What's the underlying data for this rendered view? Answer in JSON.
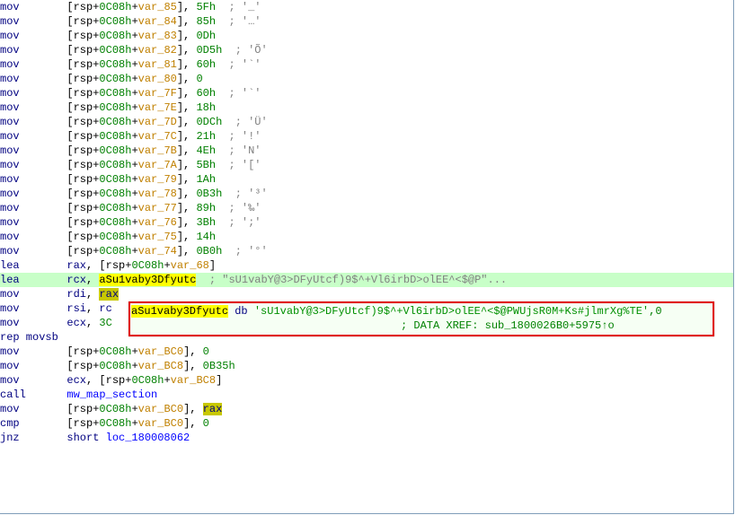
{
  "lines": [
    {
      "op": "mov",
      "dst_pre": "[rsp+",
      "off": "0C08h",
      "plus": "+",
      "var": "var_85",
      "dst_post": "], ",
      "val": "5Fh",
      "cmt": "; '_'"
    },
    {
      "op": "mov",
      "dst_pre": "[rsp+",
      "off": "0C08h",
      "plus": "+",
      "var": "var_84",
      "dst_post": "], ",
      "val": "85h",
      "cmt": "; '…'"
    },
    {
      "op": "mov",
      "dst_pre": "[rsp+",
      "off": "0C08h",
      "plus": "+",
      "var": "var_83",
      "dst_post": "], ",
      "val": "0Dh",
      "cmt": ""
    },
    {
      "op": "mov",
      "dst_pre": "[rsp+",
      "off": "0C08h",
      "plus": "+",
      "var": "var_82",
      "dst_post": "], ",
      "val": "0D5h",
      "cmt": "; 'Õ'"
    },
    {
      "op": "mov",
      "dst_pre": "[rsp+",
      "off": "0C08h",
      "plus": "+",
      "var": "var_81",
      "dst_post": "], ",
      "val": "60h",
      "cmt": "; '`'"
    },
    {
      "op": "mov",
      "dst_pre": "[rsp+",
      "off": "0C08h",
      "plus": "+",
      "var": "var_80",
      "dst_post": "], ",
      "val": "0",
      "cmt": ""
    },
    {
      "op": "mov",
      "dst_pre": "[rsp+",
      "off": "0C08h",
      "plus": "+",
      "var": "var_7F",
      "dst_post": "], ",
      "val": "60h",
      "cmt": "; '`'"
    },
    {
      "op": "mov",
      "dst_pre": "[rsp+",
      "off": "0C08h",
      "plus": "+",
      "var": "var_7E",
      "dst_post": "], ",
      "val": "18h",
      "cmt": ""
    },
    {
      "op": "mov",
      "dst_pre": "[rsp+",
      "off": "0C08h",
      "plus": "+",
      "var": "var_7D",
      "dst_post": "], ",
      "val": "0DCh",
      "cmt": "; 'Ü'"
    },
    {
      "op": "mov",
      "dst_pre": "[rsp+",
      "off": "0C08h",
      "plus": "+",
      "var": "var_7C",
      "dst_post": "], ",
      "val": "21h",
      "cmt": "; '!'"
    },
    {
      "op": "mov",
      "dst_pre": "[rsp+",
      "off": "0C08h",
      "plus": "+",
      "var": "var_7B",
      "dst_post": "], ",
      "val": "4Eh",
      "cmt": "; 'N'"
    },
    {
      "op": "mov",
      "dst_pre": "[rsp+",
      "off": "0C08h",
      "plus": "+",
      "var": "var_7A",
      "dst_post": "], ",
      "val": "5Bh",
      "cmt": "; '['"
    },
    {
      "op": "mov",
      "dst_pre": "[rsp+",
      "off": "0C08h",
      "plus": "+",
      "var": "var_79",
      "dst_post": "], ",
      "val": "1Ah",
      "cmt": ""
    },
    {
      "op": "mov",
      "dst_pre": "[rsp+",
      "off": "0C08h",
      "plus": "+",
      "var": "var_78",
      "dst_post": "], ",
      "val": "0B3h",
      "cmt": "; '³'"
    },
    {
      "op": "mov",
      "dst_pre": "[rsp+",
      "off": "0C08h",
      "plus": "+",
      "var": "var_77",
      "dst_post": "], ",
      "val": "89h",
      "cmt": "; '‰'"
    },
    {
      "op": "mov",
      "dst_pre": "[rsp+",
      "off": "0C08h",
      "plus": "+",
      "var": "var_76",
      "dst_post": "], ",
      "val": "3Bh",
      "cmt": "; ';'"
    },
    {
      "op": "mov",
      "dst_pre": "[rsp+",
      "off": "0C08h",
      "plus": "+",
      "var": "var_75",
      "dst_post": "], ",
      "val": "14h",
      "cmt": ""
    },
    {
      "op": "mov",
      "dst_pre": "[rsp+",
      "off": "0C08h",
      "plus": "+",
      "var": "var_74",
      "dst_post": "], ",
      "val": "0B0h",
      "cmt": "; '°'"
    }
  ],
  "lea1": {
    "op": "lea",
    "reg": "rax",
    "off": "0C08h",
    "var": "var_68"
  },
  "lea2": {
    "op": "lea",
    "reg": "rcx",
    "sym": "aSu1vaby3Dfyutc",
    "cmt": "; \"sU1vabY@3>DFyUtcf)9$^+Vl6irbD>olEE^<$@P\"..."
  },
  "mov_rdi": {
    "op": "mov",
    "dst": "rdi",
    "src": "rax"
  },
  "mov_rsi": {
    "op": "mov",
    "dst": "rsi",
    "src_pre": "rc",
    "src_hidden": "x"
  },
  "mov_ecx": {
    "op": "mov",
    "dst": "ecx",
    "src": "3C"
  },
  "rep": "rep movsb",
  "tail": [
    {
      "op": "mov",
      "dst_pre": "[rsp+",
      "off": "0C08h",
      "plus": "+",
      "var": "var_BC0",
      "dst_post": "], ",
      "val": "0"
    },
    {
      "op": "mov",
      "dst_pre": "[rsp+",
      "off": "0C08h",
      "plus": "+",
      "var": "var_BC8",
      "dst_post": "], ",
      "val": "0B35h"
    }
  ],
  "mov_ecx2": {
    "op": "mov",
    "dst": "ecx",
    "off": "0C08h",
    "var": "var_BC8"
  },
  "call": {
    "op": "call",
    "target": "mw_map_section"
  },
  "mov_bc0_rax": {
    "op": "mov",
    "off": "0C08h",
    "var": "var_BC0",
    "src": "rax"
  },
  "cmp": {
    "op": "cmp",
    "off": "0C08h",
    "var": "var_BC0",
    "val": "0"
  },
  "jnz": {
    "op": "jnz",
    "kw": "short",
    "target": "loc_180008062"
  },
  "tooltip": {
    "sym": "aSu1vaby3Dfyutc",
    "db": "db",
    "str": "'sU1vabY@3>DFyUtcf)9$^+Vl6irbD>olEE^<$@PWUjsR0M+Ks#jlmrXg%TE'",
    "term": ",0",
    "xref": "; DATA XREF: sub_1800026B0+5975↑o"
  }
}
